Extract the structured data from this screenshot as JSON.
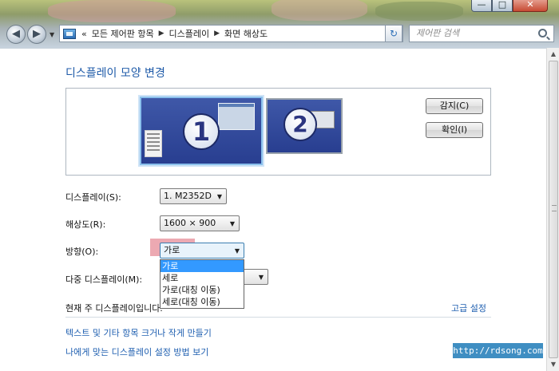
{
  "window": {
    "minimize_glyph": "—",
    "maximize_glyph": "□",
    "close_glyph": "✕"
  },
  "nav": {
    "back_glyph": "◀",
    "forward_glyph": "▶",
    "dropdown_glyph": "▼",
    "refresh_glyph": "↻"
  },
  "address": {
    "overflow": "«",
    "crumbs": [
      "모든 제어판 항목",
      "디스플레이",
      "화면 해상도"
    ],
    "separator": "▶",
    "dropdown_glyph": "▼",
    "icon": "control-panel-icon"
  },
  "search": {
    "placeholder": "제어판 검색",
    "icon": "search-icon"
  },
  "main": {
    "heading": "디스플레이 모양 변경",
    "monitors": [
      {
        "number": "1",
        "active": true
      },
      {
        "number": "2",
        "active": false
      }
    ],
    "detect_button": "감지(C)",
    "identify_button": "확인(I)",
    "display_label": "디스플레이(S):",
    "display_value": "1. M2352D",
    "resolution_label": "해상도(R):",
    "resolution_value": "1600 × 900",
    "orientation_label": "방향(O):",
    "orientation_value": "가로",
    "orientation_options": [
      "가로",
      "세로",
      "가로(대칭 이동)",
      "세로(대칭 이동)"
    ],
    "orientation_selected_index": 0,
    "multi_display_label": "다중 디스플레이(M):",
    "primary_display_text": "현재 주 디스플레이입니다.",
    "advanced_link": "고급 설정",
    "link_text_size": "텍스트 및 기타 항목 크거나 작게 만들기",
    "link_help": "나에게 맞는 디스플레이 설정 방법 보기",
    "select_arrow": "▼"
  },
  "scrollbar": {
    "up_glyph": "▲",
    "down_glyph": "▼"
  },
  "watermark": "http://rdsong.com",
  "colors": {
    "heading": "#1e5aa8",
    "link": "#1f5fb0",
    "selected_item": "#3399ff",
    "highlight": "#e99aa4",
    "watermark_bg": "#3f8ec2"
  }
}
